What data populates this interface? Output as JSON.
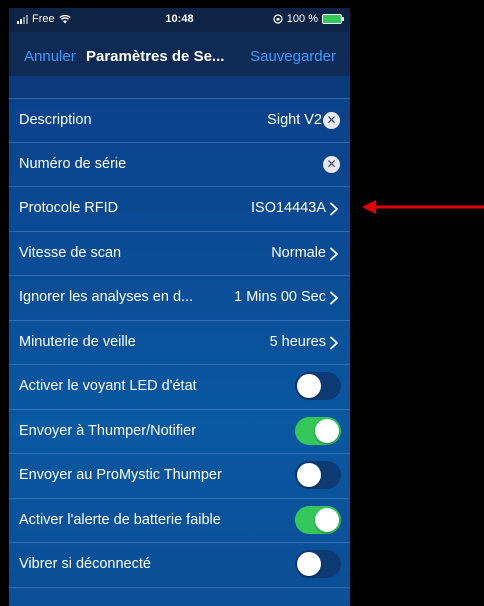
{
  "status_bar": {
    "carrier": "Free",
    "time": "10:48",
    "battery_percent": "100 %",
    "icons": [
      "signal-icon",
      "wifi-icon",
      "orientation-lock-icon",
      "battery-icon"
    ]
  },
  "nav": {
    "cancel_label": "Annuler",
    "title": "Paramètres de Se...",
    "save_label": "Sauvegarder"
  },
  "settings": [
    {
      "label": "Description",
      "value": "Sight V2",
      "kind": "clearable"
    },
    {
      "label": "Numéro de série",
      "value": "",
      "kind": "clearable"
    },
    {
      "label": "Protocole RFID",
      "value": "ISO14443A",
      "kind": "disclosure"
    },
    {
      "label": "Vitesse de scan",
      "value": "Normale",
      "kind": "disclosure"
    },
    {
      "label": "Ignorer les analyses en d...",
      "value": "1 Mins 00 Sec",
      "kind": "disclosure"
    },
    {
      "label": "Minuterie de veille",
      "value": "5 heures",
      "kind": "disclosure"
    },
    {
      "label": "Activer le voyant LED d'état",
      "on": false,
      "kind": "toggle"
    },
    {
      "label": "Envoyer à Thumper/Notifier",
      "on": true,
      "kind": "toggle"
    },
    {
      "label": "Envoyer au ProMystic Thumper",
      "on": false,
      "kind": "toggle"
    },
    {
      "label": "Activer l'alerte de batterie faible",
      "on": true,
      "kind": "toggle"
    },
    {
      "label": "Vibrer si déconnecté",
      "on": false,
      "kind": "toggle"
    }
  ],
  "colors": {
    "accent": "#3d9bff",
    "toggle_on": "#34c759",
    "annotation_arrow": "#e00000"
  }
}
